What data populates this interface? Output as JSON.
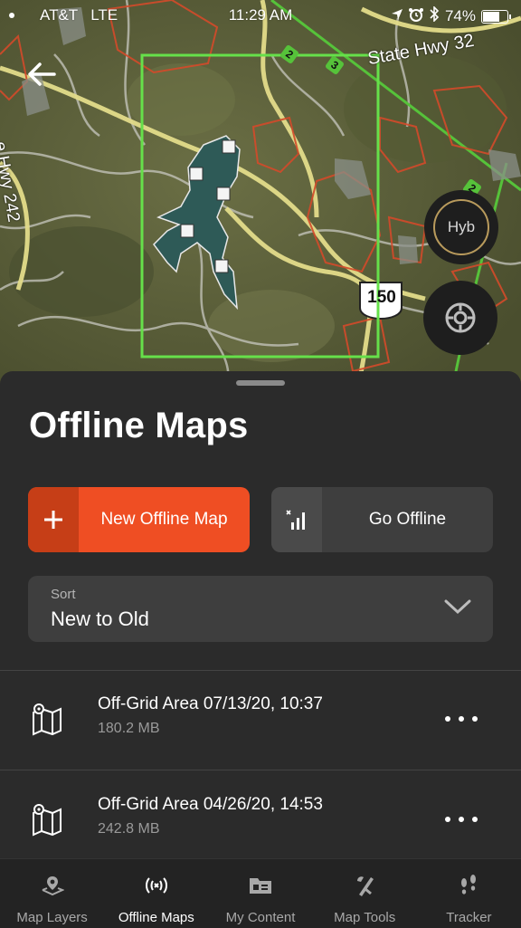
{
  "status_bar": {
    "carrier": "AT&T",
    "network": "LTE",
    "time": "11:29 AM",
    "battery_percent": "74%",
    "battery_level": 0.74
  },
  "map": {
    "labels": {
      "state_hwy": "State Hwy 32",
      "hwy_left": "e Hwy 242",
      "route_150": "150",
      "route_2a": "2",
      "route_3": "3",
      "route_2b": "2"
    },
    "selection_color": "#66e04a",
    "layer_button_label": "Hyb"
  },
  "sheet": {
    "title": "Offline Maps",
    "new_button_label": "New Offline Map",
    "go_offline_label": "Go Offline",
    "sort": {
      "caption": "Sort",
      "value": "New to Old"
    },
    "offline_maps": [
      {
        "name": "Off-Grid Area 07/13/20, 10:37",
        "size": "180.2 MB"
      },
      {
        "name": "Off-Grid Area 04/26/20, 14:53",
        "size": "242.8 MB"
      }
    ]
  },
  "tab_bar": {
    "tabs": [
      {
        "label": "Map Layers",
        "icon": "map-layers-icon",
        "active": false
      },
      {
        "label": "Offline Maps",
        "icon": "offline-signal-icon",
        "active": true
      },
      {
        "label": "My Content",
        "icon": "folder-icon",
        "active": false
      },
      {
        "label": "Map Tools",
        "icon": "tools-icon",
        "active": false
      },
      {
        "label": "Tracker",
        "icon": "footprints-icon",
        "active": false
      }
    ]
  },
  "colors": {
    "accent": "#ef4e23",
    "accent_dark": "#c63e17",
    "sheet_bg": "#2b2b2b",
    "control_bg": "#3e3e3e"
  }
}
